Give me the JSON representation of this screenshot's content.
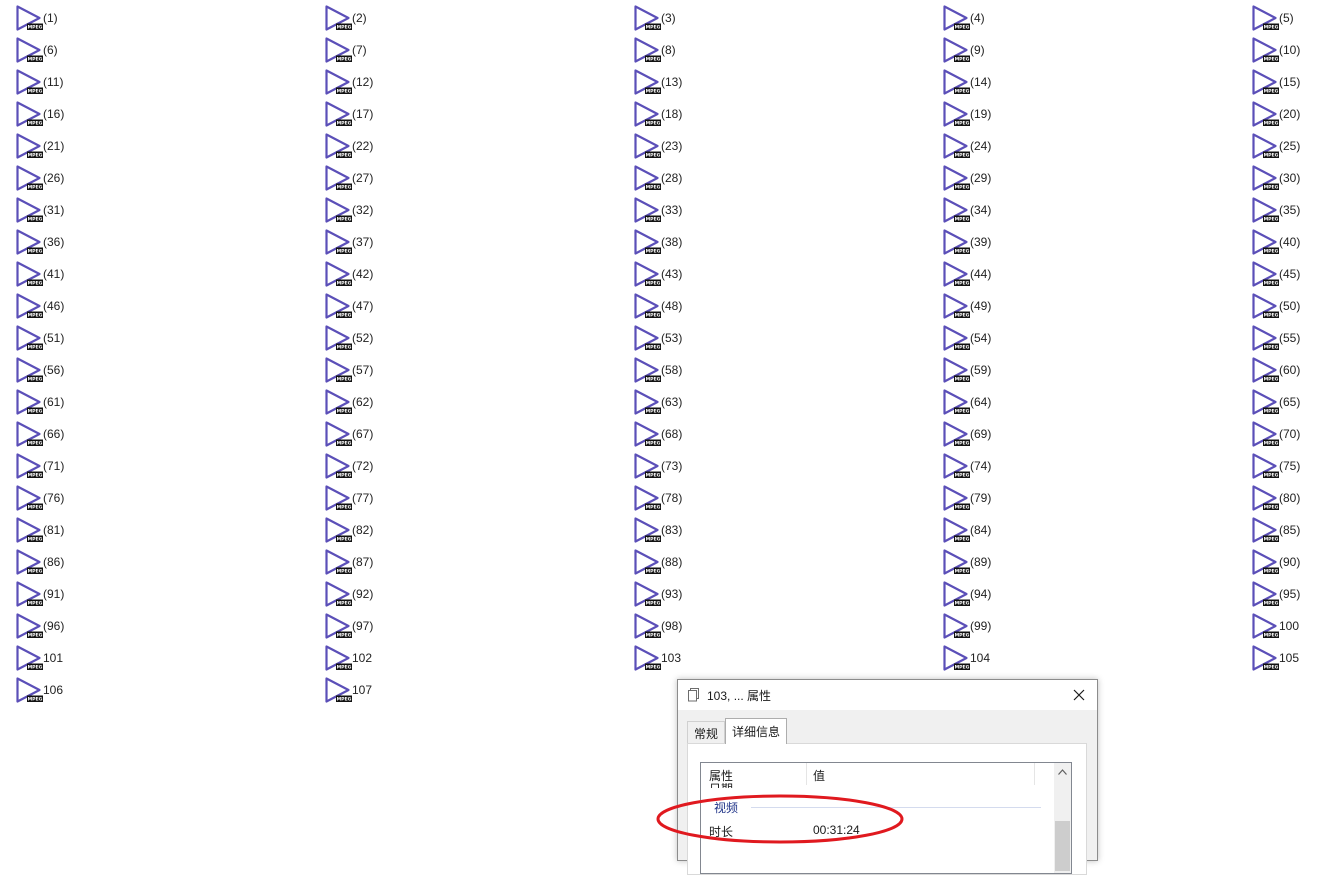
{
  "file_icon": {
    "name": "media-file-icon",
    "badge_text": "MPEG",
    "stroke_color": "#5b4fb8"
  },
  "files": [
    "(1)",
    "(2)",
    "(3)",
    "(4)",
    "(5)",
    "(6)",
    "(7)",
    "(8)",
    "(9)",
    "(10)",
    "(11)",
    "(12)",
    "(13)",
    "(14)",
    "(15)",
    "(16)",
    "(17)",
    "(18)",
    "(19)",
    "(20)",
    "(21)",
    "(22)",
    "(23)",
    "(24)",
    "(25)",
    "(26)",
    "(27)",
    "(28)",
    "(29)",
    "(30)",
    "(31)",
    "(32)",
    "(33)",
    "(34)",
    "(35)",
    "(36)",
    "(37)",
    "(38)",
    "(39)",
    "(40)",
    "(41)",
    "(42)",
    "(43)",
    "(44)",
    "(45)",
    "(46)",
    "(47)",
    "(48)",
    "(49)",
    "(50)",
    "(51)",
    "(52)",
    "(53)",
    "(54)",
    "(55)",
    "(56)",
    "(57)",
    "(58)",
    "(59)",
    "(60)",
    "(61)",
    "(62)",
    "(63)",
    "(64)",
    "(65)",
    "(66)",
    "(67)",
    "(68)",
    "(69)",
    "(70)",
    "(71)",
    "(72)",
    "(73)",
    "(74)",
    "(75)",
    "(76)",
    "(77)",
    "(78)",
    "(79)",
    "(80)",
    "(81)",
    "(82)",
    "(83)",
    "(84)",
    "(85)",
    "(86)",
    "(87)",
    "(88)",
    "(89)",
    "(90)",
    "(91)",
    "(92)",
    "(93)",
    "(94)",
    "(95)",
    "(96)",
    "(97)",
    "(98)",
    "(99)",
    "100",
    "101",
    "102",
    "103",
    "104",
    "105",
    "106",
    "107"
  ],
  "dialog": {
    "title": "103, ... 属性",
    "tabs": [
      "常规",
      "详细信息"
    ],
    "active_tab": "详细信息",
    "columns": {
      "property": "属性",
      "value": "值"
    },
    "clipped_row": "日期",
    "group": "视频",
    "rows": [
      {
        "name": "时长",
        "value": "00:31:24"
      }
    ],
    "annotation_color": "#e0191f"
  }
}
